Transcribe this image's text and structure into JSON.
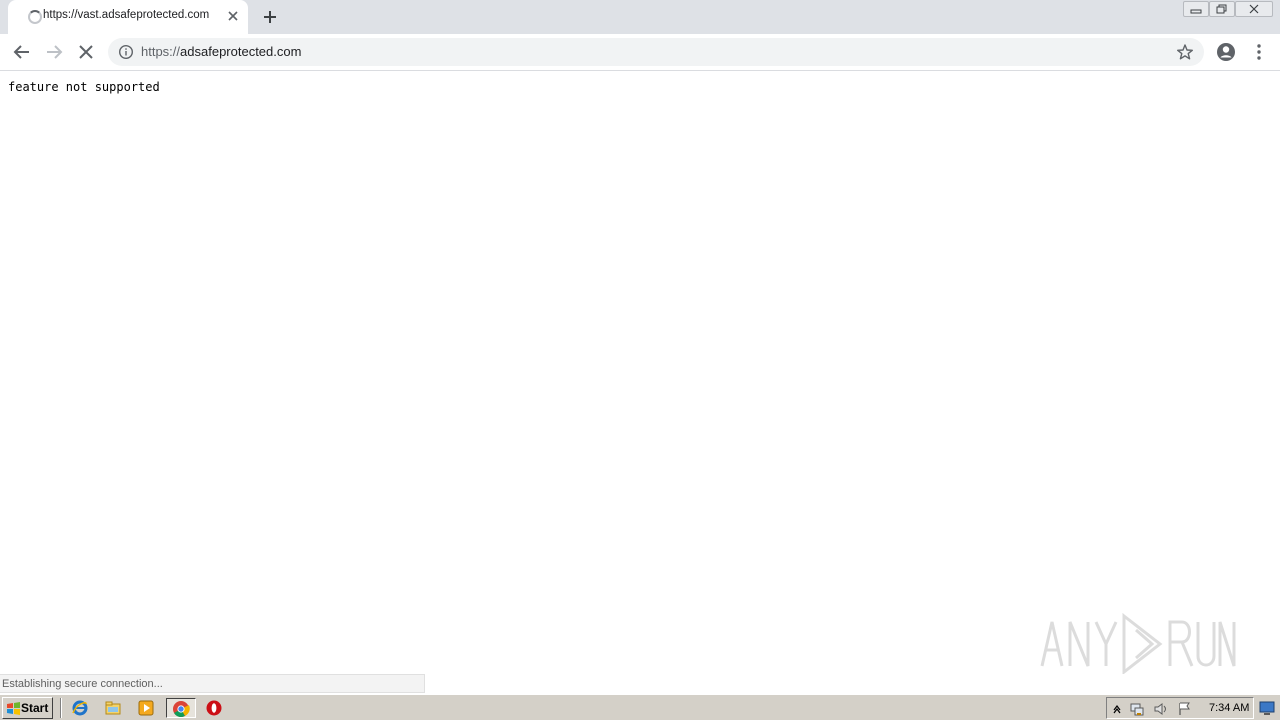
{
  "browser": {
    "tab": {
      "title": "https://vast.adsafeprotected.com",
      "loading": true
    },
    "new_tab_icon": "plus-icon",
    "window_controls": [
      "minimize-icon",
      "restore-icon",
      "close-icon"
    ],
    "toolbar": {
      "back_icon": "arrow-left-icon",
      "forward_icon": "arrow-right-icon",
      "stop_icon": "close-icon",
      "site_info_icon": "info-icon",
      "url_scheme": "https://",
      "url_host": "adsafeprotected.com",
      "bookmark_icon": "star-icon",
      "profile_icon": "account-icon",
      "menu_icon": "kebab-menu-icon"
    },
    "status_text": "Establishing secure connection..."
  },
  "page": {
    "message": "feature not supported"
  },
  "watermark": {
    "text": "ANY RUN"
  },
  "taskbar": {
    "start_label": "Start",
    "apps": [
      "internet-explorer-icon",
      "file-explorer-icon",
      "media-player-icon",
      "chrome-icon",
      "opera-icon"
    ],
    "active_app": "chrome-icon",
    "tray_icons": [
      "tray-expand-icon",
      "network-icon",
      "volume-icon",
      "action-center-flag-icon"
    ],
    "clock": "7:34 AM"
  },
  "colors": {
    "tabstrip": "#dee1e6",
    "omnibox": "#f1f3f4",
    "taskbar": "#d4d0c8",
    "chrome_icon_gray": "#5f6368"
  }
}
